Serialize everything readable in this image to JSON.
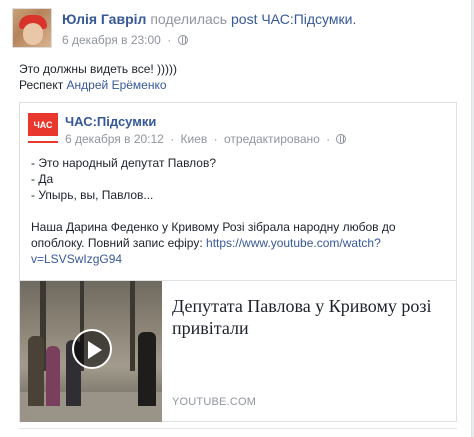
{
  "post": {
    "author": "Юлія Гаврiл",
    "action": "поделилась",
    "post_link": "post ЧАС:Підсумки.",
    "date": "6 декабря в 23:00",
    "dot": "·",
    "privacy_icon": "globe-icon",
    "text_line1": "Это должны видеть все! )))))",
    "text_line2_prefix": "Респект",
    "mention": "Андрей Ерёменко"
  },
  "shared": {
    "page_name": "ЧАС:Підсумки",
    "logo_text": "ЧАС",
    "date": "6 декабря в 20:12",
    "location": "Киев",
    "edited": "отредактировано",
    "dot": "·",
    "privacy_icon": "globe-icon",
    "lines": [
      "- Это народный депутат Павлов?",
      "- Да",
      "- Упырь, вы, Павлов..."
    ],
    "para_line1": "Наша Дарина Феденко у Кривому Розі зібрала народну любов до",
    "para_line2_prefix": "опоблоку. Повний запис ефіру: ",
    "link_part1": "https://www.youtube.com/watch?",
    "link_part2": "v=LSVSwIzgG94"
  },
  "link_card": {
    "title": "Депутата Павлова у Кривому розі привітали",
    "domain": "YOUTUBE.COM",
    "play_icon": "play-icon"
  },
  "colors": {
    "link": "#365899",
    "meta": "#90949c",
    "text": "#1d2129",
    "logo_red": "#e8382e"
  }
}
